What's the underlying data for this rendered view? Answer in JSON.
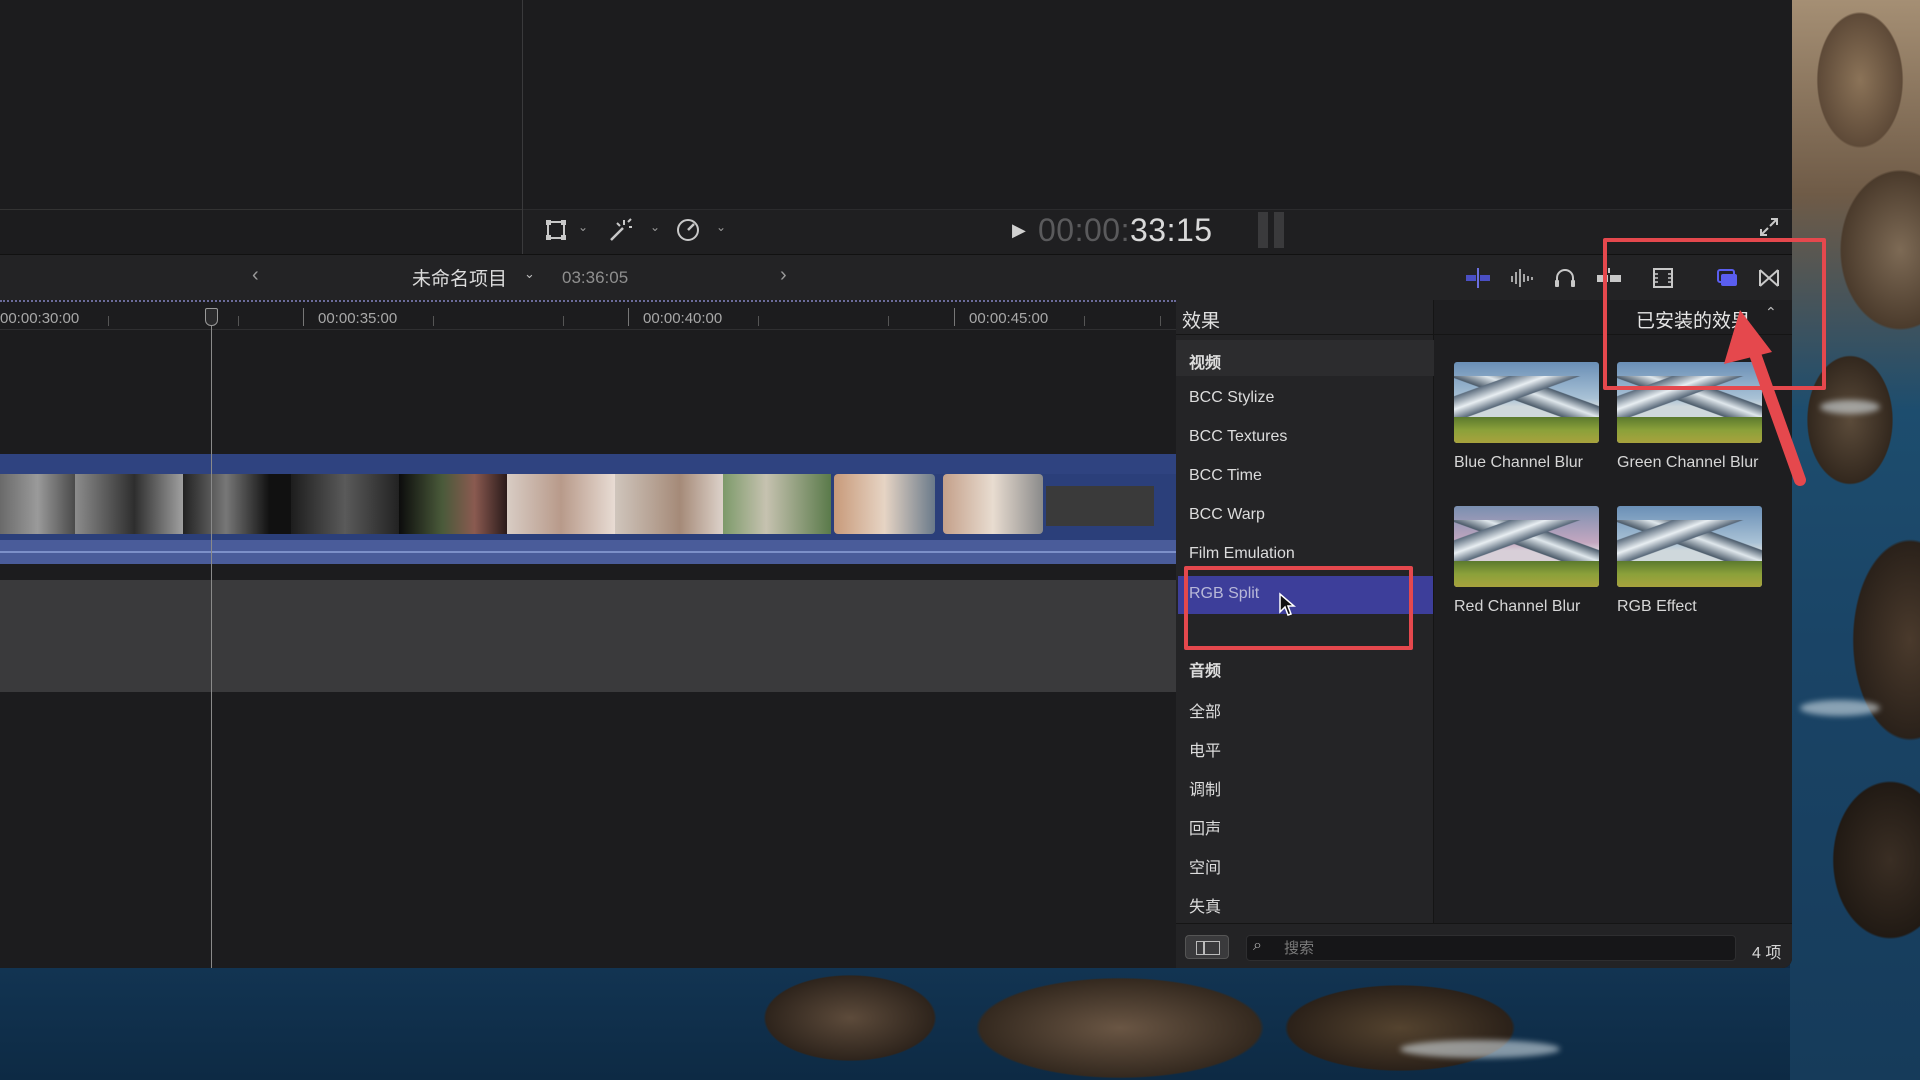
{
  "viewer": {
    "timecode_dim": "00:00:",
    "timecode_lit": "33:15",
    "play_icon": "play-icon"
  },
  "timeline": {
    "project_name": "未命名项目",
    "project_duration": "03:36:05",
    "ruler_labels": [
      "00:00:30:00",
      "00:00:35:00",
      "00:00:40:00",
      "00:00:45:00"
    ]
  },
  "effects": {
    "title": "效果",
    "filter_label": "已安装的效果",
    "categories": {
      "video": "视频",
      "bcc_stylize": "BCC Stylize",
      "bcc_textures": "BCC Textures",
      "bcc_time": "BCC Time",
      "bcc_warp": "BCC Warp",
      "film_emulation": "Film Emulation",
      "rgb_split": "RGB Split",
      "audio": "音频",
      "all": "全部",
      "levels": "电平",
      "modulation": "调制",
      "echo": "回声",
      "space": "空间",
      "distortion": "失真"
    },
    "selected_category": "RGB Split",
    "items": [
      {
        "label": "Blue Channel Blur"
      },
      {
        "label": "Green Channel Blur"
      },
      {
        "label": "Red Channel Blur"
      },
      {
        "label": "RGB Effect"
      }
    ],
    "search_placeholder": "搜索",
    "item_count": "4 项"
  },
  "colors": {
    "accent": "#3d3e9a",
    "clip_blue": "#2b3f7a",
    "annotation_red": "#e5484d"
  }
}
